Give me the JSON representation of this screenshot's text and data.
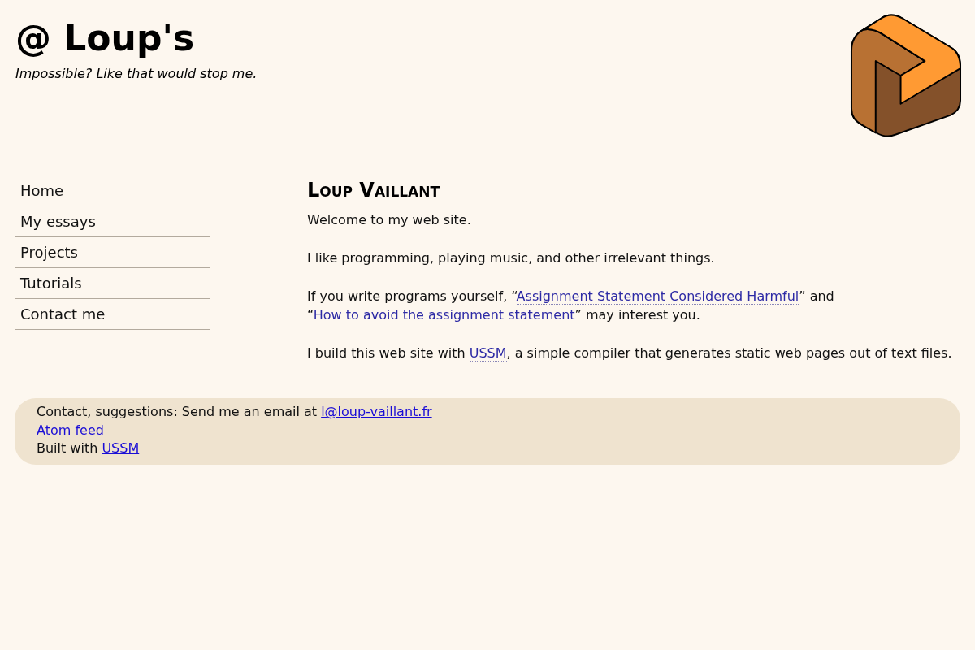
{
  "header": {
    "title": "@ Loup's",
    "tagline": "Impossible? Like that would stop me."
  },
  "nav": {
    "items": [
      {
        "label": "Home"
      },
      {
        "label": "My essays"
      },
      {
        "label": "Projects"
      },
      {
        "label": "Tutorials"
      },
      {
        "label": "Contact me"
      }
    ]
  },
  "main": {
    "heading": "Loup Vaillant",
    "paragraphs": [
      [
        {
          "kind": "text",
          "text": "Welcome to my web site."
        }
      ],
      [
        {
          "kind": "text",
          "text": "I like programming, playing music, and other irrelevant things."
        }
      ],
      [
        {
          "kind": "text",
          "text": "If you write programs yourself, “"
        },
        {
          "kind": "link",
          "text": "Assignment Statement Considered Harmful"
        },
        {
          "kind": "text",
          "text": "” and “"
        },
        {
          "kind": "link",
          "text": "How to avoid the assignment statement"
        },
        {
          "kind": "text",
          "text": "” may interest you."
        }
      ],
      [
        {
          "kind": "text",
          "text": "I build this web site with "
        },
        {
          "kind": "link",
          "text": "USSM"
        },
        {
          "kind": "text",
          "text": ", a simple compiler that generates static web pages out of text files."
        }
      ]
    ]
  },
  "footer": {
    "lines": [
      [
        {
          "kind": "text",
          "text": "Contact, suggestions: Send me an email at "
        },
        {
          "kind": "link",
          "text": "l@loup-vaillant.fr"
        }
      ],
      [
        {
          "kind": "link",
          "text": "Atom feed"
        }
      ],
      [
        {
          "kind": "text",
          "text": "Built with "
        },
        {
          "kind": "link",
          "text": "USSM"
        }
      ]
    ]
  }
}
